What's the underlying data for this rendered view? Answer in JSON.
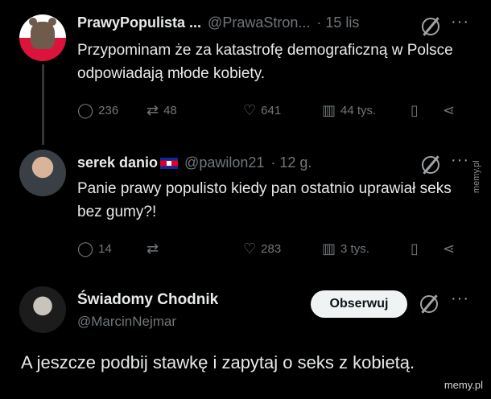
{
  "tweets": [
    {
      "name": "PrawyPopulista ...",
      "handle": "@PrawaStron...",
      "time": "· 15 lis",
      "text": "Przypominam że za katastrofę demograficzną w Polsce odpowiadają młode kobiety.",
      "replies": "236",
      "retweets": "48",
      "likes": "641",
      "views": "44 tys."
    },
    {
      "name": "serek danio",
      "handle": "@pawilon21",
      "time": "· 12 g.",
      "text": "Panie prawy populisto kiedy pan ostatnio uprawiał seks bez gumy?!",
      "replies": "14",
      "retweets": "",
      "likes": "283",
      "views": "3 tys."
    }
  ],
  "third": {
    "name": "Świadomy Chodnik",
    "handle": "@MarcinNejmar",
    "follow_label": "Obserwuj",
    "text": "A jeszcze podbij stawkę i zapytaj o seks z kobietą."
  },
  "watermarks": {
    "side": "memy.pl",
    "bottom": "memy.pl"
  },
  "icons": [
    "reply-icon",
    "retweet-icon",
    "like-icon",
    "views-icon",
    "bookmark-icon",
    "share-icon",
    "grok-icon",
    "more-icon"
  ]
}
